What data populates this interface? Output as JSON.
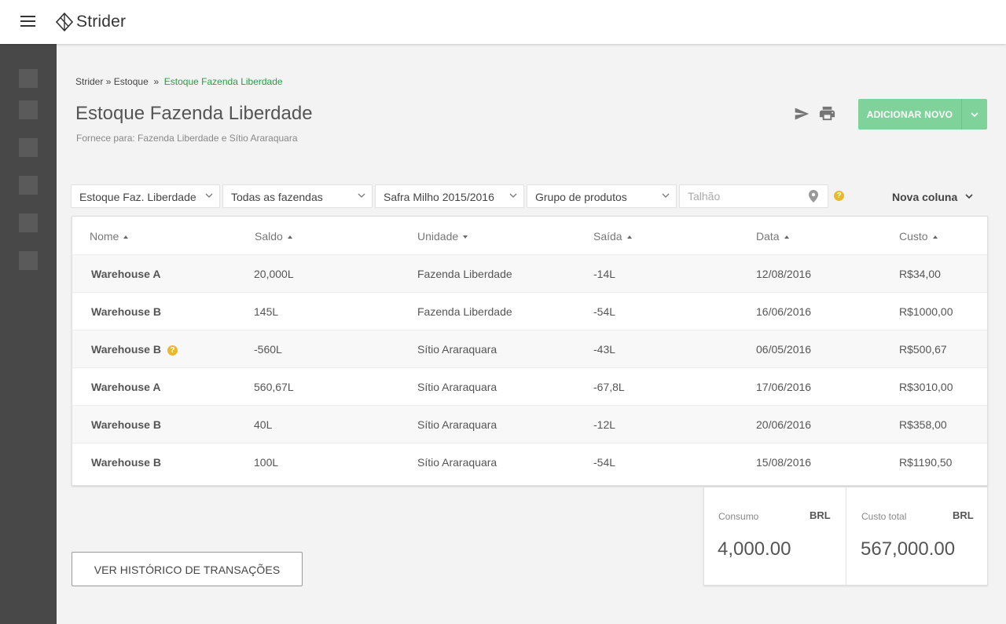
{
  "app": {
    "title": "Strider"
  },
  "breadcrumb": {
    "root": "Strider",
    "sep1": "»",
    "section": "Estoque",
    "sep2": "»",
    "current": "Estoque Fazenda Liberdade"
  },
  "page": {
    "title": "Estoque Fazenda Liberdade",
    "subtitle": "Fornece para: Fazenda Liberdade e Sítio Araraquara"
  },
  "actions": {
    "add_label": "ADICIONAR NOVO"
  },
  "filters": {
    "estoque": "Estoque Faz.  Liberdade",
    "fazendas": "Todas as fazendas",
    "safra": "Safra Milho 2015/2016",
    "grupo": "Grupo de produtos",
    "talhao_placeholder": "Talhão",
    "help": "?",
    "nova_coluna": "Nova coluna"
  },
  "table": {
    "columns": [
      "Nome",
      "Saldo",
      "Unidade",
      "Saída",
      "Data",
      "Custo"
    ],
    "rows": [
      {
        "nome": "Warehouse A",
        "saldo": "20,000L",
        "unidade": "Fazenda Liberdade",
        "saida": "-14L",
        "data": "12/08/2016",
        "custo": "R$34,00",
        "help": ""
      },
      {
        "nome": "Warehouse B",
        "saldo": "145L",
        "unidade": "Fazenda Liberdade",
        "saida": "-54L",
        "data": "16/06/2016",
        "custo": "R$1000,00",
        "help": ""
      },
      {
        "nome": "Warehouse B",
        "saldo": "-560L",
        "unidade": "Sítio Araraquara",
        "saida": "-43L",
        "data": "06/05/2016",
        "custo": "R$500,67",
        "help": "?"
      },
      {
        "nome": "Warehouse A",
        "saldo": "560,67L",
        "unidade": "Sítio Araraquara",
        "saida": "-67,8L",
        "data": "17/06/2016",
        "custo": "R$3010,00",
        "help": ""
      },
      {
        "nome": "Warehouse B",
        "saldo": "40L",
        "unidade": "Sítio Araraquara",
        "saida": "-12L",
        "data": "20/06/2016",
        "custo": "R$358,00",
        "help": ""
      },
      {
        "nome": "Warehouse B",
        "saldo": "100L",
        "unidade": "Sítio Araraquara",
        "saida": "-54L",
        "data": "15/08/2016",
        "custo": "R$1190,50",
        "help": ""
      }
    ]
  },
  "summary": {
    "consumo": {
      "label": "Consumo",
      "currency": "BRL",
      "value": "4,000.00"
    },
    "custo_total": {
      "label": "Custo total",
      "currency": "BRL",
      "value": "567,000.00"
    }
  },
  "history_button": "VER HISTÓRICO DE TRANSAÇÕES",
  "colors": {
    "accent_green": "#7fd39a",
    "breadcrumb_green": "#2d9a46",
    "sidebar": "#484848",
    "warning": "#e8b92f"
  }
}
